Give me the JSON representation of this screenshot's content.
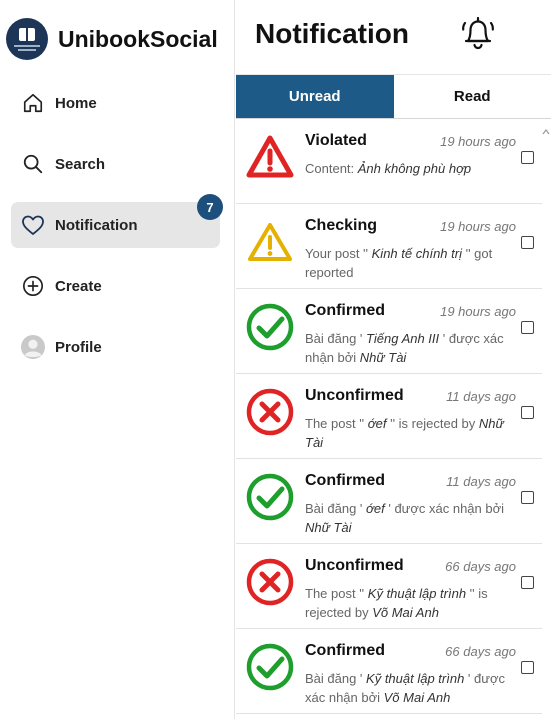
{
  "app": {
    "name": "UnibookSocial"
  },
  "sidebar": {
    "items": [
      {
        "label": "Home",
        "icon": "home-icon"
      },
      {
        "label": "Search",
        "icon": "search-icon"
      },
      {
        "label": "Notification",
        "icon": "heart-icon",
        "badge": "7",
        "active": true
      },
      {
        "label": "Create",
        "icon": "plus-circle-icon"
      },
      {
        "label": "Profile",
        "icon": "avatar-icon"
      }
    ]
  },
  "main": {
    "title": "Notification",
    "tabs": [
      {
        "label": "Unread",
        "active": true
      },
      {
        "label": "Read",
        "active": false
      }
    ]
  },
  "colors": {
    "accent": "#1d5a87",
    "badge": "#1d4f7c",
    "violated": "#e02424",
    "checking": "#e5b100",
    "confirmed": "#1e9e2c",
    "unconfirmed": "#e02424"
  },
  "notifications": [
    {
      "status": "Violated",
      "icon": "warning-red-icon",
      "time": "19 hours ago",
      "body": [
        {
          "t": "Content: "
        },
        {
          "t": "Ảnh không phù hợp",
          "i": true
        }
      ]
    },
    {
      "status": "Checking",
      "icon": "warning-yellow-icon",
      "time": "19 hours ago",
      "body": [
        {
          "t": "Your post '' "
        },
        {
          "t": "Kinh tế chính trị",
          "i": true
        },
        {
          "t": " '' got reported"
        }
      ]
    },
    {
      "status": "Confirmed",
      "icon": "check-circle-icon",
      "time": "19 hours ago",
      "body": [
        {
          "t": "Bài đăng ' "
        },
        {
          "t": "Tiếng Anh III",
          "i": true
        },
        {
          "t": " ' được xác nhận bởi "
        },
        {
          "t": "Nhữ Tài",
          "i": true
        }
      ]
    },
    {
      "status": "Unconfirmed",
      "icon": "x-circle-icon",
      "time": "11 days ago",
      "body": [
        {
          "t": "The post '' "
        },
        {
          "t": "ớef",
          "i": true
        },
        {
          "t": " '' is rejected by "
        },
        {
          "t": "Nhữ Tài",
          "i": true
        }
      ]
    },
    {
      "status": "Confirmed",
      "icon": "check-circle-icon",
      "time": "11 days ago",
      "body": [
        {
          "t": "Bài đăng ' "
        },
        {
          "t": "ớef",
          "i": true
        },
        {
          "t": " ' được xác nhận bởi "
        },
        {
          "t": "Nhữ Tài",
          "i": true
        }
      ]
    },
    {
      "status": "Unconfirmed",
      "icon": "x-circle-icon",
      "time": "66 days ago",
      "body": [
        {
          "t": "The post '' "
        },
        {
          "t": "Kỹ thuật lập trình",
          "i": true
        },
        {
          "t": " '' is rejected by "
        },
        {
          "t": "Võ Mai Anh",
          "i": true
        }
      ]
    },
    {
      "status": "Confirmed",
      "icon": "check-circle-icon",
      "time": "66 days ago",
      "body": [
        {
          "t": "Bài đăng ' "
        },
        {
          "t": "Kỹ thuật lập trình",
          "i": true
        },
        {
          "t": " ' được xác nhận bởi "
        },
        {
          "t": "Võ Mai Anh",
          "i": true
        }
      ]
    }
  ]
}
